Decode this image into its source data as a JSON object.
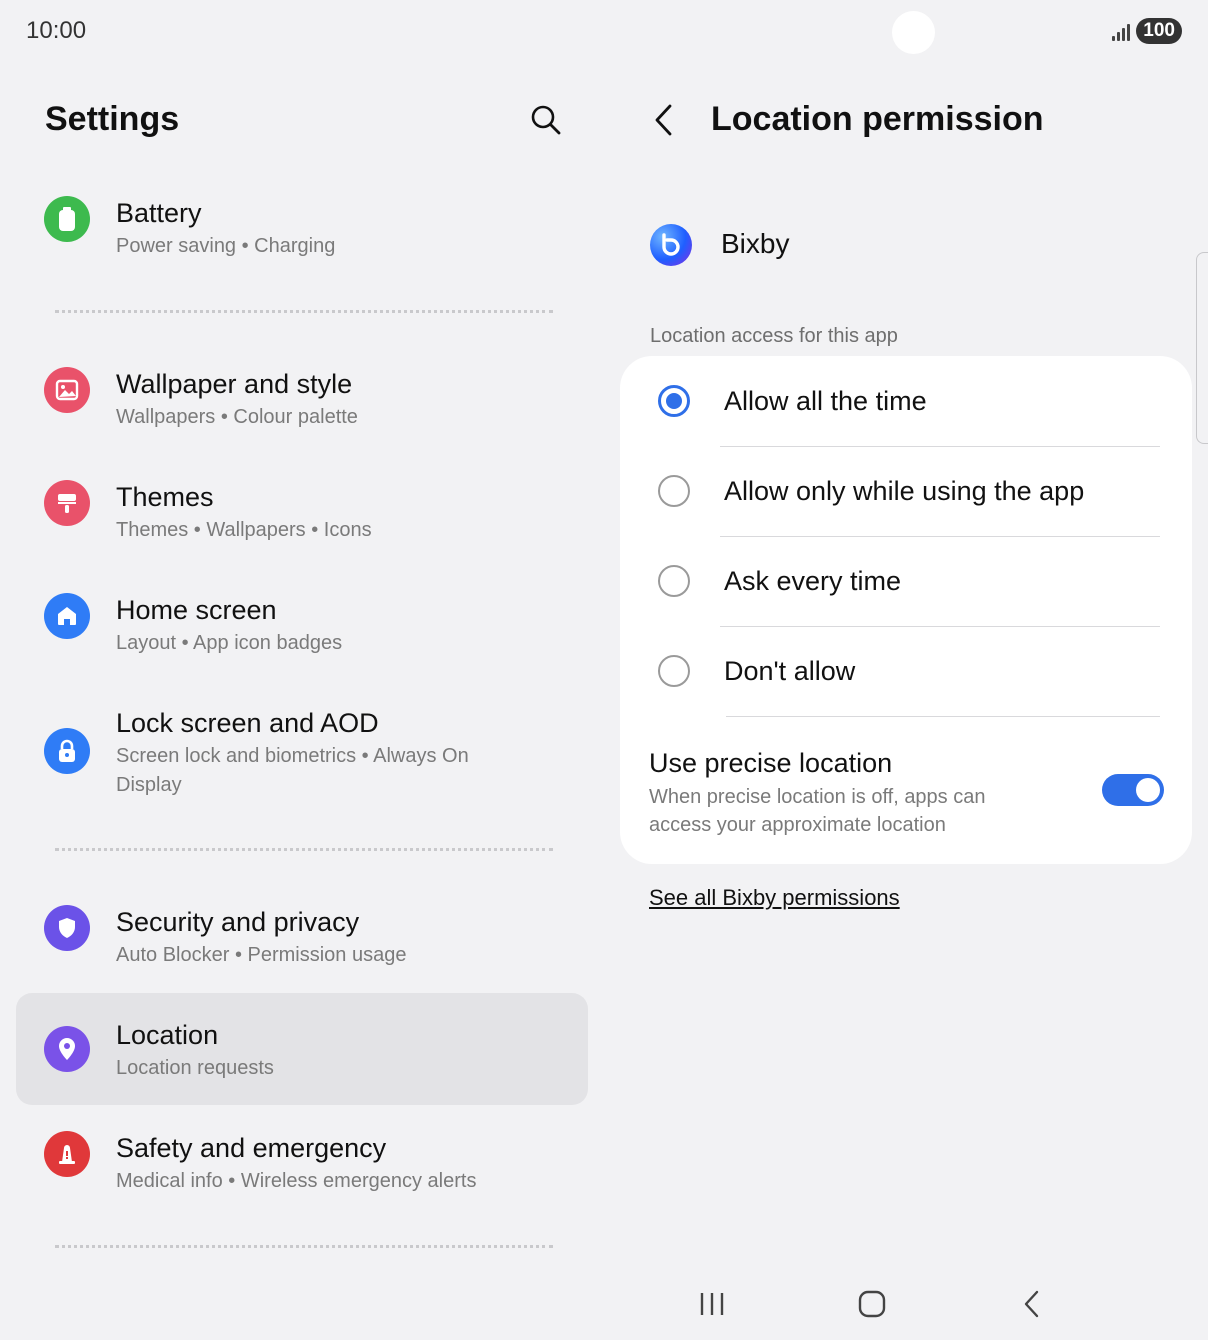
{
  "status_bar": {
    "time": "10:00",
    "battery": "100"
  },
  "left_pane": {
    "title": "Settings",
    "items": [
      {
        "title": "Battery",
        "subtitle": "Power saving  •  Charging",
        "icon": "battery-icon",
        "color": "#3dba4e"
      },
      {
        "title": "Wallpaper and style",
        "subtitle": "Wallpapers  •  Colour palette",
        "icon": "wallpaper-icon",
        "color": "#e9526a"
      },
      {
        "title": "Themes",
        "subtitle": "Themes  •  Wallpapers  •  Icons",
        "icon": "themes-brush-icon",
        "color": "#e9526a"
      },
      {
        "title": "Home screen",
        "subtitle": "Layout  •  App icon badges",
        "icon": "home-icon",
        "color": "#2f7cf6"
      },
      {
        "title": "Lock screen and AOD",
        "subtitle": "Screen lock and biometrics  •  Always On Display",
        "icon": "lock-icon",
        "color": "#2f7cf6"
      },
      {
        "title": "Security and privacy",
        "subtitle": "Auto Blocker  •  Permission usage",
        "icon": "shield-icon",
        "color": "#6b52e8"
      },
      {
        "title": "Location",
        "subtitle": "Location requests",
        "icon": "location-pin-icon",
        "color": "#7a52e8",
        "selected": true
      },
      {
        "title": "Safety and emergency",
        "subtitle": "Medical info  •  Wireless emergency alerts",
        "icon": "emergency-icon",
        "color": "#e0383a"
      }
    ]
  },
  "right_pane": {
    "title": "Location permission",
    "app_name": "Bixby",
    "section_label": "Location access for this app",
    "options": [
      {
        "label": "Allow all the time",
        "checked": true
      },
      {
        "label": "Allow only while using the app",
        "checked": false
      },
      {
        "label": "Ask every time",
        "checked": false
      },
      {
        "label": "Don't allow",
        "checked": false
      }
    ],
    "precise": {
      "title": "Use precise location",
      "description": "When precise location is off, apps can access your approximate location",
      "enabled": true
    },
    "link": "See all Bixby permissions"
  },
  "colors": {
    "accent": "#2f6fe8",
    "background": "#f2f2f4",
    "card": "#ffffff"
  }
}
